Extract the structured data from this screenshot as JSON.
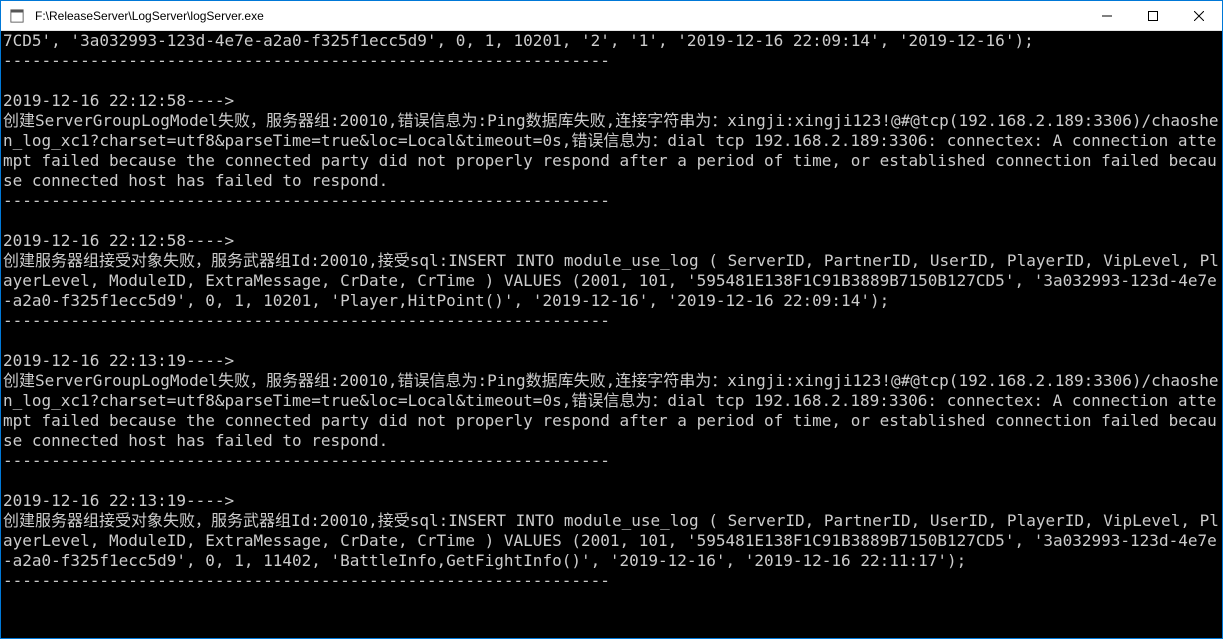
{
  "window": {
    "title": "F:\\ReleaseServer\\LogServer\\logServer.exe"
  },
  "console": {
    "lines": [
      "7CD5', '3a032993-123d-4e7e-a2a0-f325f1ecc5d9', 0, 1, 10201, '2', '1', '2019-12-16 22:09:14', '2019-12-16');",
      "---------------------------------------------------------------",
      "",
      "2019-12-16 22:12:58---->",
      "创建ServerGroupLogModel失败，服务器组:20010,错误信息为:Ping数据库失败,连接字符串为：xingji:xingji123!@#@tcp(192.168.2.189:3306)/chaoshen_log_xc1?charset=utf8&parseTime=true&loc=Local&timeout=0s,错误信息为：dial tcp 192.168.2.189:3306: connectex: A connection attempt failed because the connected party did not properly respond after a period of time, or established connection failed because connected host has failed to respond.",
      "---------------------------------------------------------------",
      "",
      "2019-12-16 22:12:58---->",
      "创建服务器组接受对象失败，服务武器组Id:20010,接受sql:INSERT INTO module_use_log ( ServerID, PartnerID, UserID, PlayerID, VipLevel, PlayerLevel, ModuleID, ExtraMessage, CrDate, CrTime ) VALUES (2001, 101, '595481E138F1C91B3889B7150B127CD5', '3a032993-123d-4e7e-a2a0-f325f1ecc5d9', 0, 1, 10201, 'Player,HitPoint()', '2019-12-16', '2019-12-16 22:09:14');",
      "---------------------------------------------------------------",
      "",
      "2019-12-16 22:13:19---->",
      "创建ServerGroupLogModel失败，服务器组:20010,错误信息为:Ping数据库失败,连接字符串为：xingji:xingji123!@#@tcp(192.168.2.189:3306)/chaoshen_log_xc1?charset=utf8&parseTime=true&loc=Local&timeout=0s,错误信息为：dial tcp 192.168.2.189:3306: connectex: A connection attempt failed because the connected party did not properly respond after a period of time, or established connection failed because connected host has failed to respond.",
      "---------------------------------------------------------------",
      "",
      "2019-12-16 22:13:19---->",
      "创建服务器组接受对象失败，服务武器组Id:20010,接受sql:INSERT INTO module_use_log ( ServerID, PartnerID, UserID, PlayerID, VipLevel, PlayerLevel, ModuleID, ExtraMessage, CrDate, CrTime ) VALUES (2001, 101, '595481E138F1C91B3889B7150B127CD5', '3a032993-123d-4e7e-a2a0-f325f1ecc5d9', 0, 1, 11402, 'BattleInfo,GetFightInfo()', '2019-12-16', '2019-12-16 22:11:17');",
      "---------------------------------------------------------------"
    ]
  }
}
